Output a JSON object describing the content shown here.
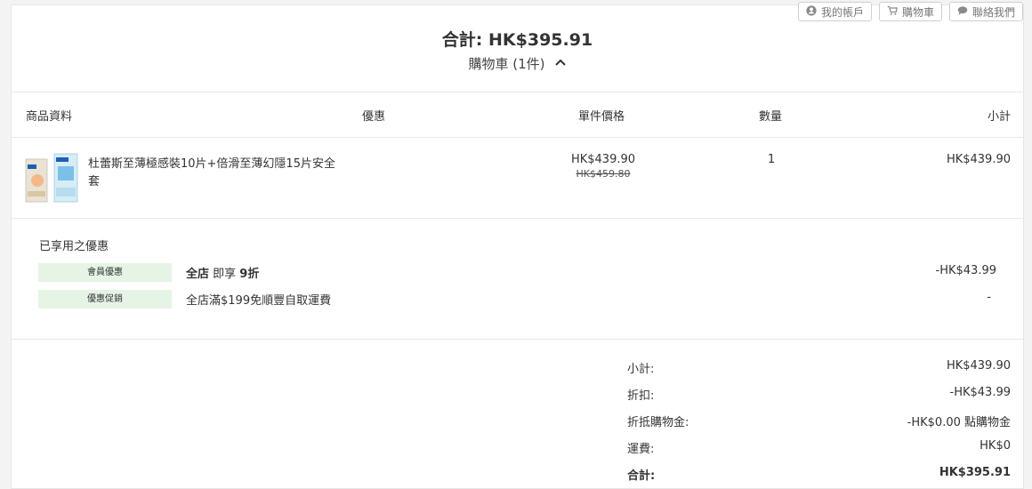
{
  "header_links": {
    "account": "我的帳戶",
    "cart": "購物車",
    "contact": "聯絡我們"
  },
  "summary": {
    "grand_total": "合計: HK$395.91",
    "cart_toggle": "購物車 (1件)"
  },
  "table": {
    "columns": [
      "商品資料",
      "優惠",
      "單件價格",
      "數量",
      "小計"
    ],
    "rows": [
      {
        "name": "杜蕾斯至薄極感裝10片+倍滑至薄幻隱15片安全套",
        "unit_price": "HK$439.90",
        "original_price": "HK$459.80",
        "quantity": "1",
        "subtotal": "HK$439.90"
      }
    ]
  },
  "discounts": {
    "title": "已享用之優惠",
    "items": [
      {
        "tag": "會員優惠",
        "desc_bold": "全店",
        "desc_mid": " 即享 ",
        "desc_bold2": "9折",
        "amount": "-HK$43.99"
      },
      {
        "tag": "優惠促銷",
        "desc": "全店滿$199免順豐自取運費",
        "amount": "-"
      }
    ]
  },
  "totals": [
    {
      "label": "小計:",
      "value": "HK$439.90"
    },
    {
      "label": "折扣:",
      "value": "-HK$43.99"
    },
    {
      "label": "折抵購物金:",
      "value": "-HK$0.00 點購物金"
    },
    {
      "label": "運費:",
      "value": "HK$0"
    },
    {
      "label": "合計:",
      "value": "HK$395.91"
    }
  ],
  "colors": {
    "promo_tag_bg": "#e6f4e6",
    "border": "#e8e8e8",
    "text": "#333333"
  }
}
